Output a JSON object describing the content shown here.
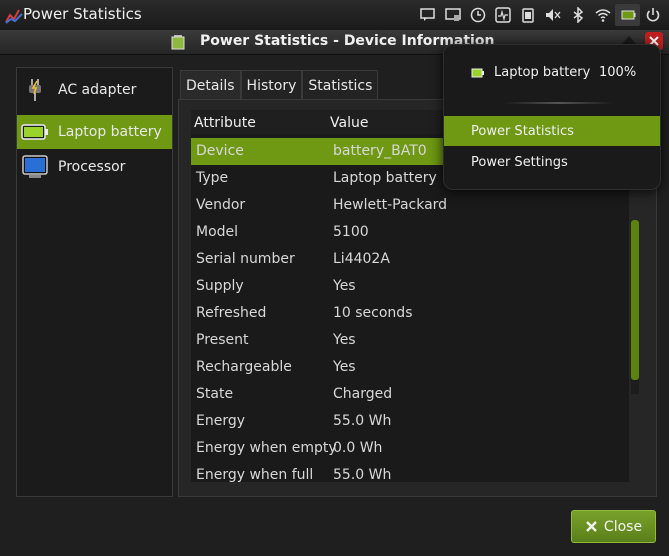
{
  "panel": {
    "app_name": "Power Statistics",
    "tray_icons": [
      "notification-icon",
      "display-icon",
      "clock-icon",
      "system-monitor-icon",
      "clipboard-icon",
      "volume-muted-icon",
      "bluetooth-icon",
      "wifi-icon",
      "battery-icon",
      "power-icon"
    ]
  },
  "window": {
    "title": "Power Statistics - Device Information"
  },
  "devices": [
    {
      "label": "AC adapter",
      "icon": "ac-adapter-icon"
    },
    {
      "label": "Laptop battery",
      "icon": "battery-icon"
    },
    {
      "label": "Processor",
      "icon": "processor-icon"
    }
  ],
  "tabs": [
    "Details",
    "History",
    "Statistics"
  ],
  "table": {
    "headers": [
      "Attribute",
      "Value"
    ],
    "rows": [
      {
        "attr": "Device",
        "value": "battery_BAT0"
      },
      {
        "attr": "Type",
        "value": "Laptop battery"
      },
      {
        "attr": "Vendor",
        "value": "Hewlett-Packard"
      },
      {
        "attr": "Model",
        "value": "5100"
      },
      {
        "attr": "Serial number",
        "value": "Li4402A"
      },
      {
        "attr": "Supply",
        "value": "Yes"
      },
      {
        "attr": "Refreshed",
        "value": "10 seconds"
      },
      {
        "attr": "Present",
        "value": "Yes"
      },
      {
        "attr": "Rechargeable",
        "value": "Yes"
      },
      {
        "attr": "State",
        "value": "Charged"
      },
      {
        "attr": "Energy",
        "value": "55.0 Wh"
      },
      {
        "attr": "Energy when empty",
        "value": "0.0 Wh"
      },
      {
        "attr": "Energy when full",
        "value": "55.0 Wh"
      }
    ]
  },
  "buttons": {
    "close": "Close"
  },
  "popup": {
    "battery_label": "Laptop battery",
    "battery_percent": "100%",
    "items": [
      "Power Statistics",
      "Power Settings"
    ]
  },
  "colors": {
    "accent": "#6f9813"
  }
}
